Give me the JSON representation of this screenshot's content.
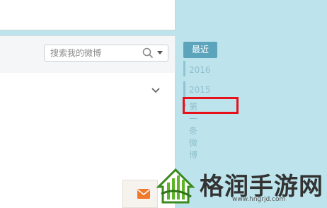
{
  "search": {
    "placeholder": "搜索我的微博"
  },
  "timeline": {
    "current_label": "最近",
    "years": [
      "2016",
      "2015"
    ],
    "first_post_label": "第一条微博"
  },
  "watermark": {
    "title": "格润手游网",
    "url": "www.hngrjd.com"
  },
  "colors": {
    "sidebar_bg": "#bde4ec",
    "timeline_accent": "#5ba4bb",
    "highlight": "#e8111a",
    "mail_orange": "#f07a2a",
    "logo_green": "#3a8a1e"
  }
}
